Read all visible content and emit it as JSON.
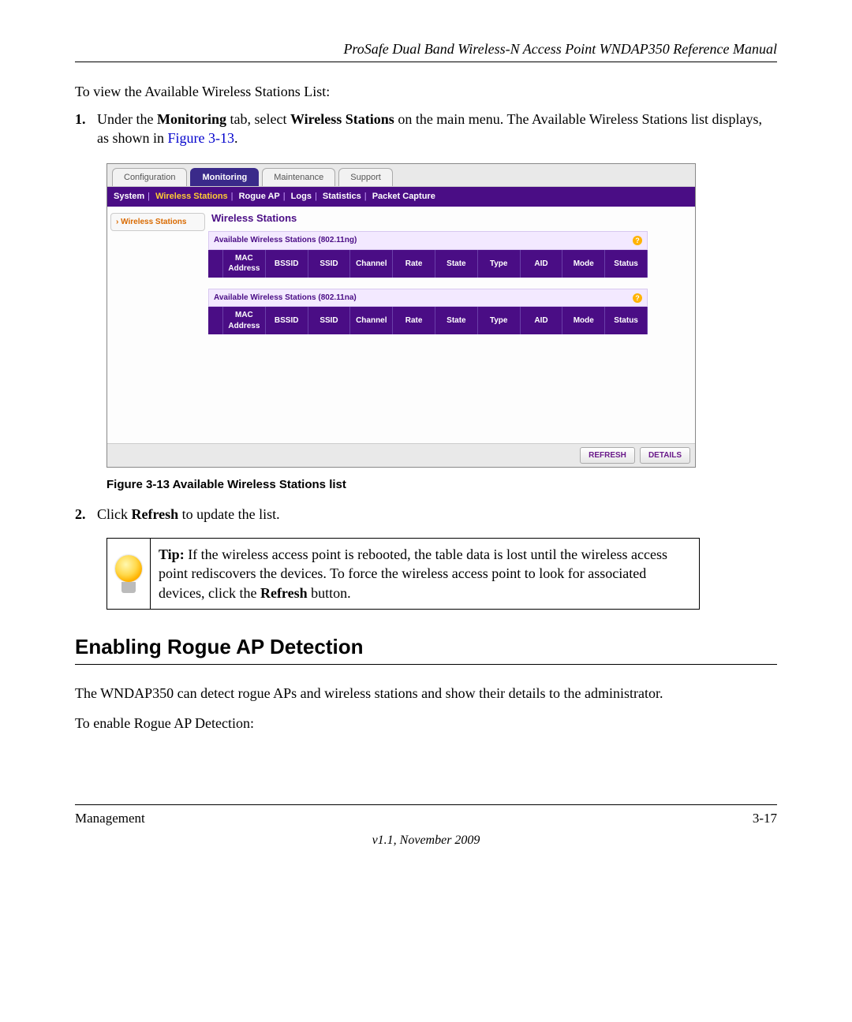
{
  "header": {
    "doc_title": "ProSafe Dual Band Wireless-N Access Point WNDAP350 Reference Manual"
  },
  "intro": "To view the Available Wireless Stations List:",
  "steps": [
    {
      "num": "1.",
      "prefix": "Under the ",
      "b1": "Monitoring",
      "mid1": " tab, select ",
      "b2": "Wireless Stations",
      "mid2": " on the main menu. The Available Wireless Stations list displays, as shown in ",
      "figlink": "Figure 3-13",
      "suffix": "."
    },
    {
      "num": "2.",
      "prefix": "Click ",
      "b1": "Refresh",
      "suffix": " to update the list."
    }
  ],
  "screenshot": {
    "tabs": [
      "Configuration",
      "Monitoring",
      "Maintenance",
      "Support"
    ],
    "active_tab": "Monitoring",
    "submenu": [
      "System",
      "Wireless Stations",
      "Rogue AP",
      "Logs",
      "Statistics",
      "Packet Capture"
    ],
    "submenu_selected": "Wireless Stations",
    "side_item": "Wireless Stations",
    "panel_title": "Wireless Stations",
    "table_ng": "Available Wireless Stations (802.11ng)",
    "table_na": "Available Wireless Stations (802.11na)",
    "columns": [
      "",
      "MAC Address",
      "BSSID",
      "SSID",
      "Channel",
      "Rate",
      "State",
      "Type",
      "AID",
      "Mode",
      "Status"
    ],
    "buttons": {
      "refresh": "REFRESH",
      "details": "DETAILS"
    }
  },
  "figcaption": "Figure 3-13  Available Wireless Stations list",
  "tip": {
    "label": "Tip:",
    "body_1": " If the wireless access point is rebooted, the table data is lost until the wireless access point rediscovers the devices. To force the wireless access point to look for associated devices, click the ",
    "bold": "Refresh",
    "body_2": " button."
  },
  "section_heading": "Enabling Rogue AP Detection",
  "para1": "The WNDAP350 can detect rogue APs and wireless stations and show their details to the administrator.",
  "para2": "To enable Rogue AP Detection:",
  "footer": {
    "left": "Management",
    "right": "3-17",
    "version": "v1.1, November 2009"
  }
}
